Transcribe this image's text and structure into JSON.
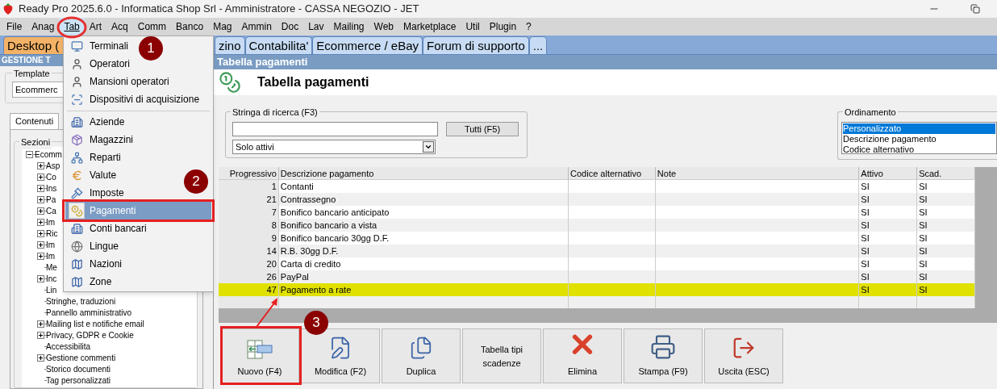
{
  "window": {
    "title": "Ready Pro 2025.6.0 - Informatica Shop Srl - Amministratore - CASSA NEGOZIO - JET"
  },
  "menu_bar": [
    {
      "label": "File",
      "selected": false
    },
    {
      "label": "Anag",
      "selected": false
    },
    {
      "label": "Tab",
      "selected": true
    },
    {
      "label": "Art",
      "selected": false
    },
    {
      "label": "Acq",
      "selected": false
    },
    {
      "label": "Comm",
      "selected": false
    },
    {
      "label": "Banco",
      "selected": false
    },
    {
      "label": "Mag",
      "selected": false
    },
    {
      "label": "Ammin",
      "selected": false
    },
    {
      "label": "Doc",
      "selected": false
    },
    {
      "label": "Lav",
      "selected": false
    },
    {
      "label": "Mailing",
      "selected": false
    },
    {
      "label": "Web",
      "selected": false
    },
    {
      "label": "Marketplace",
      "selected": false
    },
    {
      "label": "Util",
      "selected": false
    },
    {
      "label": "Plugin",
      "selected": false
    },
    {
      "label": "?",
      "selected": false
    }
  ],
  "module_tabs": [
    {
      "label": "Desktop (",
      "selected": true
    },
    {
      "label": "zino",
      "selected": false
    },
    {
      "label": "Contabilita'",
      "selected": false
    },
    {
      "label": "Ecommerce / eBay",
      "selected": false
    },
    {
      "label": "Forum di supporto",
      "selected": false
    },
    {
      "label": "...",
      "selected": false
    }
  ],
  "dropdown_menu": [
    {
      "kind": "terminal",
      "label": "Terminali",
      "selected": false
    },
    {
      "kind": "user",
      "label": "Operatori",
      "selected": false
    },
    {
      "kind": "user",
      "label": "Mansioni operatori",
      "selected": false
    },
    {
      "kind": "scanner",
      "label": "Dispositivi di acquisizione",
      "selected": false
    },
    {
      "kind": "separator"
    },
    {
      "kind": "building",
      "label": "Aziende",
      "selected": false
    },
    {
      "kind": "boxes",
      "label": "Magazzini",
      "selected": false
    },
    {
      "kind": "network",
      "label": "Reparti",
      "selected": false
    },
    {
      "kind": "coin",
      "label": "Valute",
      "selected": false
    },
    {
      "kind": "gavel",
      "label": "Imposte",
      "selected": false
    },
    {
      "kind": "money",
      "label": "Pagamenti",
      "selected": true
    },
    {
      "kind": "building",
      "label": "Conti bancari",
      "selected": false
    },
    {
      "kind": "globe",
      "label": "Lingue",
      "selected": false
    },
    {
      "kind": "map",
      "label": "Nazioni",
      "selected": false
    },
    {
      "kind": "map",
      "label": "Zone",
      "selected": false
    }
  ],
  "left_panel": {
    "header": "GESTIONE T",
    "template": {
      "label": "Template",
      "value": "Ecommerc"
    },
    "tabs": [
      {
        "label": "Contenuti",
        "selected": true
      }
    ],
    "sections": {
      "label": "Sezioni",
      "tree": [
        {
          "label": "Ecomm",
          "expanded": true,
          "children": [
            {
              "label": "Asp",
              "expanded": false
            },
            {
              "label": "Co",
              "expanded": false
            },
            {
              "label": "Ins",
              "expanded": false
            },
            {
              "label": "Pa",
              "expanded": false
            },
            {
              "label": "Ca",
              "expanded": false
            },
            {
              "label": "Im",
              "expanded": false
            },
            {
              "label": "Ric",
              "expanded": false
            },
            {
              "label": "Im",
              "expanded": false
            },
            {
              "label": "Im",
              "expanded": false
            },
            {
              "label": "Me"
            },
            {
              "label": "Inc",
              "expanded": false
            },
            {
              "label": "Lin"
            },
            {
              "label": "Stringhe, traduzioni"
            },
            {
              "label": "Pannello amministrativo"
            },
            {
              "label": "Mailing list e notifiche email",
              "expanded": false
            },
            {
              "label": "Privacy, GDPR e Cookie",
              "expanded": false
            },
            {
              "label": "Accessibilita"
            },
            {
              "label": "Gestione commenti",
              "expanded": false
            },
            {
              "label": "Storico documenti"
            },
            {
              "label": "Tag personalizzati"
            }
          ]
        }
      ]
    }
  },
  "content": {
    "header": "Tabella pagamenti",
    "title": "Tabella pagamenti",
    "search": {
      "label": "Stringa di ricerca (F3)",
      "button": "Tutti (F5)",
      "filter": "Solo attivi"
    },
    "ordering": {
      "label": "Ordinamento",
      "options": [
        {
          "label": "Personalizzato",
          "selected": true
        },
        {
          "label": "Descrizione pagamento",
          "selected": false
        },
        {
          "label": "Codice alternativo",
          "selected": false
        }
      ]
    },
    "table": {
      "columns": [
        "Progressivo",
        "Descrizione pagamento",
        "Codice alternativo",
        "Note",
        "Attivo",
        "Scad."
      ],
      "rows": [
        {
          "cells": [
            "1",
            "Contanti",
            "",
            "",
            "SI",
            "SI"
          ],
          "selected": false
        },
        {
          "cells": [
            "21",
            "Contrassegno",
            "",
            "",
            "SI",
            "SI"
          ],
          "selected": false
        },
        {
          "cells": [
            "7",
            "Bonifico bancario anticipato",
            "",
            "",
            "SI",
            "SI"
          ],
          "selected": false
        },
        {
          "cells": [
            "8",
            "Bonifico bancario a vista",
            "",
            "",
            "SI",
            "SI"
          ],
          "selected": false
        },
        {
          "cells": [
            "9",
            "Bonifico bancario 30gg D.F.",
            "",
            "",
            "SI",
            "SI"
          ],
          "selected": false
        },
        {
          "cells": [
            "14",
            "R.B. 30gg D.F.",
            "",
            "",
            "SI",
            "SI"
          ],
          "selected": false
        },
        {
          "cells": [
            "20",
            "Carta di credito",
            "",
            "",
            "SI",
            "SI"
          ],
          "selected": false
        },
        {
          "cells": [
            "26",
            "PayPal",
            "",
            "",
            "SI",
            "SI"
          ],
          "selected": false
        },
        {
          "cells": [
            "47",
            "Pagamento a rate",
            "",
            "",
            "SI",
            "SI"
          ],
          "selected": true
        }
      ]
    },
    "buttons": [
      {
        "kind": "new",
        "label": "Nuovo (F4)"
      },
      {
        "kind": "edit",
        "label": "Modifica (F2)"
      },
      {
        "kind": "duplicate",
        "label": "Duplica"
      },
      {
        "kind": "text",
        "label": "Tabella tipi scadenze"
      },
      {
        "kind": "delete",
        "label": "Elimina"
      },
      {
        "kind": "print",
        "label": "Stampa (F9)"
      },
      {
        "kind": "exit",
        "label": "Uscita (ESC)"
      }
    ]
  },
  "step_badges": [
    "1",
    "2",
    "3"
  ]
}
